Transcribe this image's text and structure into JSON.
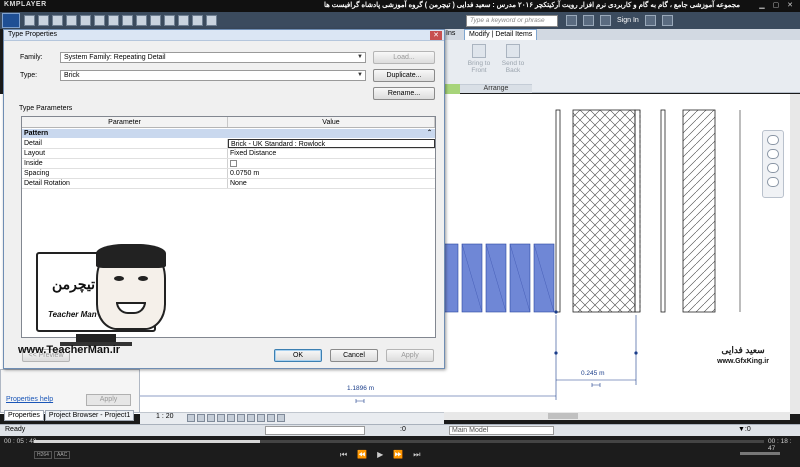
{
  "player": {
    "logo": "KMPLAYER",
    "caption": "مجموعه آموزشی جامع ، گام به گام و کاربردی نرم افزار رویت آرکیتکچر ۲۰۱۶   مدرس : سعید فدایی ( تیچرمن ) گروه آموزشی پادشاه گرافیست ها",
    "time_elapsed": "00 : 05 : 48",
    "time_total": "00 : 18 : 47",
    "progress_fraction": 0.31,
    "badges": [
      "H264",
      "AAC"
    ],
    "controls": [
      "⏮",
      "⏪",
      "▶",
      "⏩",
      "⏭"
    ]
  },
  "app": {
    "search_placeholder": "Type a keyword or phrase",
    "signin": "Sign In",
    "ribbon": {
      "tab_partial": "Ins",
      "tab_active": "Modify | Detail Items",
      "panel_arrange": "Arrange",
      "bring_to_front": "Bring to Front",
      "send_to_back": "Send to Back"
    },
    "dimensions": {
      "d1": "1.1896 m",
      "d2": "0.245 m"
    },
    "properties_help": "Properties help",
    "apply": "Apply",
    "panel_tabs": [
      "Properties",
      "Project Browser - Project1"
    ],
    "scale": "1 : 20",
    "status_ready": "Ready",
    "status_zero": ":0",
    "model": "Main Model"
  },
  "dialog": {
    "title": "Type Properties",
    "family_label": "Family:",
    "family_value": "System Family: Repeating Detail",
    "type_label": "Type:",
    "type_value": "Brick",
    "load_btn": "Load...",
    "duplicate_btn": "Duplicate...",
    "rename_btn": "Rename...",
    "type_params_label": "Type Parameters",
    "col_parameter": "Parameter",
    "col_value": "Value",
    "section": "Pattern",
    "rows": [
      {
        "name": "Detail",
        "value": "Brick - UK Standard : Rowlock"
      },
      {
        "name": "Layout",
        "value": "Fixed Distance"
      },
      {
        "name": "Inside",
        "value": ""
      },
      {
        "name": "Spacing",
        "value": "0.0750 m"
      },
      {
        "name": "Detail Rotation",
        "value": "None"
      }
    ],
    "preview_btn": "<< Preview",
    "ok_btn": "OK",
    "cancel_btn": "Cancel",
    "apply_btn": "Apply"
  },
  "watermark": {
    "tm_logo": "تیچرمن",
    "tm_name": "Teacher Man",
    "tm_url": "www.TeacherMan.ir",
    "gfx_logo": "سعید فدایی",
    "gfx_url": "www.GfxKing.ir"
  },
  "colors": {
    "brick_fill": "#6f87d6",
    "dimension": "#1a3d8a",
    "selection_green": "#a7d47a"
  }
}
